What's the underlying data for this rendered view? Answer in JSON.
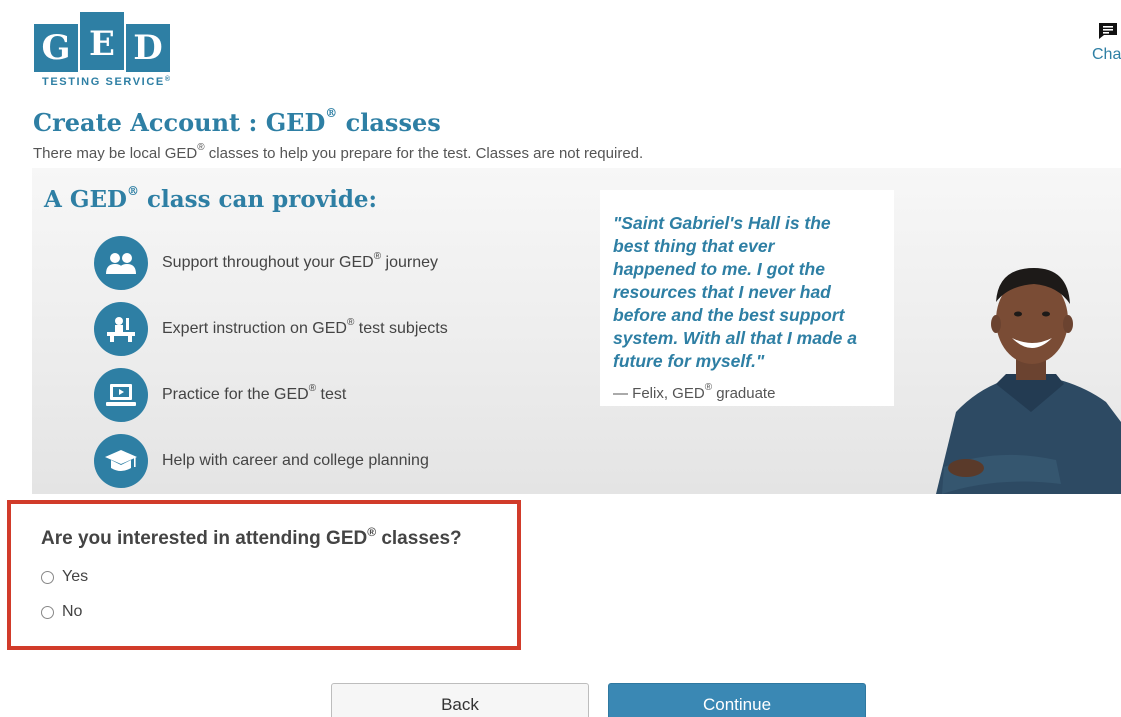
{
  "logo": {
    "letters": [
      "G",
      "E",
      "D"
    ],
    "subtitle": "TESTING SERVICE",
    "trademark": "®",
    "color": "#2e7fa4"
  },
  "chat": {
    "label": "Cha",
    "icon": "chat-icon"
  },
  "header": {
    "title_prefix": "Create Account : GED",
    "title_reg": "®",
    "title_suffix": " classes",
    "subtitle_before": "There may be local GED",
    "subtitle_reg": "®",
    "subtitle_after": " classes to help you prepare for the test. Classes are not required."
  },
  "banner": {
    "title_prefix": "A GED",
    "title_reg": "®",
    "title_suffix": " class can provide:",
    "benefits": [
      {
        "icon": "people-icon",
        "before": "Support throughout your GED",
        "reg": "®",
        "after": " journey"
      },
      {
        "icon": "teacher-desk-icon",
        "before": "Expert instruction on GED",
        "reg": "®",
        "after": " test subjects"
      },
      {
        "icon": "computer-icon",
        "before": "Practice for the GED",
        "reg": "®",
        "after": " test"
      },
      {
        "icon": "graduation-cap-icon",
        "before": "Help with career and college planning",
        "reg": "",
        "after": ""
      }
    ],
    "quote": {
      "lines": [
        "\"Saint Gabriel's Hall is the",
        "best thing that ever",
        "happened to me. I got the",
        "resources that I never had",
        "before and the best support",
        "system. With all that I made a",
        "future for myself.\""
      ],
      "attribution_before": "— Felix, GED",
      "attribution_reg": "®",
      "attribution_after": " graduate"
    }
  },
  "form": {
    "question_before": "Are you interested in attending GED",
    "question_reg": "®",
    "question_after": " classes?",
    "options": [
      "Yes",
      "No"
    ],
    "highlight_color": "#d13b2a"
  },
  "buttons": {
    "back": "Back",
    "continue": "Continue",
    "continue_color": "#3a88b4"
  }
}
